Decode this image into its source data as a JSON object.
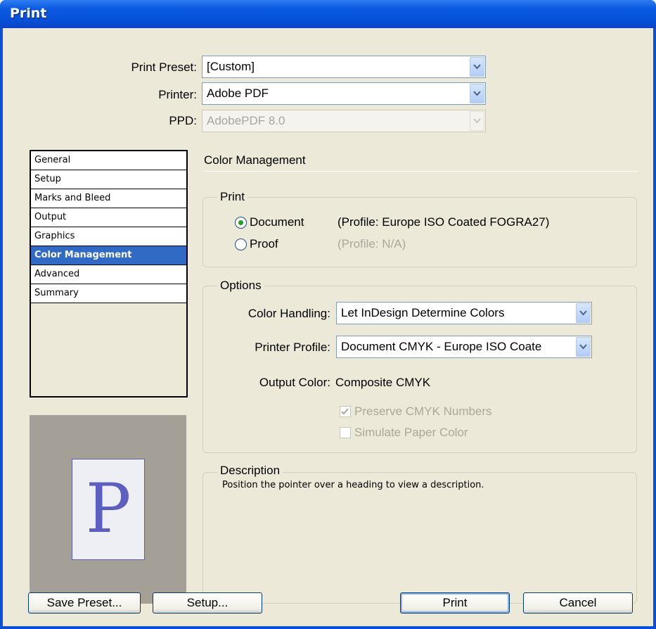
{
  "window": {
    "title": "Print"
  },
  "top": {
    "preset_label": "Print Preset:",
    "preset_value": "[Custom]",
    "printer_label": "Printer:",
    "printer_value": "Adobe PDF",
    "ppd_label": "PPD:",
    "ppd_value": "AdobePDF 8.0"
  },
  "sidebar": {
    "items": [
      {
        "label": "General"
      },
      {
        "label": "Setup"
      },
      {
        "label": "Marks and Bleed"
      },
      {
        "label": "Output"
      },
      {
        "label": "Graphics"
      },
      {
        "label": "Color Management"
      },
      {
        "label": "Advanced"
      },
      {
        "label": "Summary"
      }
    ],
    "selected": "Color Management",
    "preview_glyph": "P"
  },
  "main": {
    "title": "Color Management",
    "print_group": {
      "legend": "Print",
      "document_label": "Document",
      "document_profile": "(Profile: Europe ISO Coated FOGRA27)",
      "proof_label": "Proof",
      "proof_profile": "(Profile: N/A)",
      "selected": "Document"
    },
    "options_group": {
      "legend": "Options",
      "color_handling_label": "Color Handling:",
      "color_handling_value": "Let InDesign Determine Colors",
      "printer_profile_label": "Printer Profile:",
      "printer_profile_value": "Document CMYK - Europe ISO Coate",
      "output_color_label": "Output Color:",
      "output_color_value": "Composite CMYK",
      "preserve_label": "Preserve CMYK Numbers",
      "preserve_checked": true,
      "simulate_label": "Simulate Paper Color",
      "simulate_checked": false
    },
    "description_group": {
      "legend": "Description",
      "text": "Position the pointer over a heading to view a description."
    }
  },
  "buttons": {
    "save_preset": "Save Preset...",
    "setup": "Setup...",
    "print": "Print",
    "cancel": "Cancel"
  },
  "colors": {
    "titlebar": "#0650d8",
    "selection": "#316ac5",
    "dialog_bg": "#ece9d8"
  }
}
